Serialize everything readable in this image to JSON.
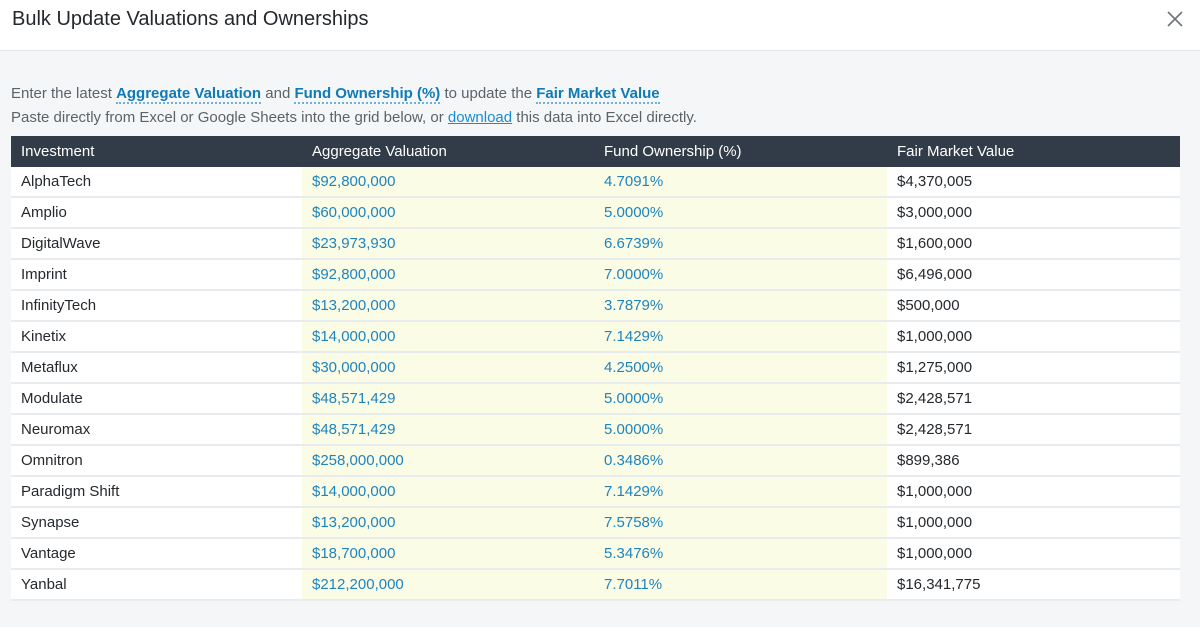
{
  "dialog": {
    "title": "Bulk Update Valuations and Ownerships",
    "close_glyph": "✕"
  },
  "intro": {
    "line1_prefix": "Enter the latest ",
    "term_aggregate": "Aggregate Valuation",
    "and": " and ",
    "term_ownership": "Fund Ownership (%)",
    "to_update": " to update the ",
    "term_fmv": "Fair Market Value",
    "line2_prefix": "Paste directly from Excel or Google Sheets into the grid below, or ",
    "download_link": "download",
    "line2_suffix": " this data into Excel directly."
  },
  "table": {
    "columns": [
      "Investment",
      "Aggregate Valuation",
      "Fund Ownership (%)",
      "Fair Market Value"
    ],
    "rows": [
      {
        "investment": "AlphaTech",
        "valuation": "$92,800,000",
        "ownership": "4.7091%",
        "fmv": "$4,370,005"
      },
      {
        "investment": "Amplio",
        "valuation": "$60,000,000",
        "ownership": "5.0000%",
        "fmv": "$3,000,000"
      },
      {
        "investment": "DigitalWave",
        "valuation": "$23,973,930",
        "ownership": "6.6739%",
        "fmv": "$1,600,000"
      },
      {
        "investment": "Imprint",
        "valuation": "$92,800,000",
        "ownership": "7.0000%",
        "fmv": "$6,496,000"
      },
      {
        "investment": "InfinityTech",
        "valuation": "$13,200,000",
        "ownership": "3.7879%",
        "fmv": "$500,000"
      },
      {
        "investment": "Kinetix",
        "valuation": "$14,000,000",
        "ownership": "7.1429%",
        "fmv": "$1,000,000"
      },
      {
        "investment": "Metaflux",
        "valuation": "$30,000,000",
        "ownership": "4.2500%",
        "fmv": "$1,275,000"
      },
      {
        "investment": "Modulate",
        "valuation": "$48,571,429",
        "ownership": "5.0000%",
        "fmv": "$2,428,571"
      },
      {
        "investment": "Neuromax",
        "valuation": "$48,571,429",
        "ownership": "5.0000%",
        "fmv": "$2,428,571"
      },
      {
        "investment": "Omnitron",
        "valuation": "$258,000,000",
        "ownership": "0.3486%",
        "fmv": "$899,386"
      },
      {
        "investment": "Paradigm Shift",
        "valuation": "$14,000,000",
        "ownership": "7.1429%",
        "fmv": "$1,000,000"
      },
      {
        "investment": "Synapse",
        "valuation": "$13,200,000",
        "ownership": "7.5758%",
        "fmv": "$1,000,000"
      },
      {
        "investment": "Vantage",
        "valuation": "$18,700,000",
        "ownership": "5.3476%",
        "fmv": "$1,000,000"
      },
      {
        "investment": "Yanbal",
        "valuation": "$212,200,000",
        "ownership": "7.7011%",
        "fmv": "$16,341,775"
      }
    ]
  },
  "colors": {
    "header_bg": "#313c48",
    "editable_bg": "#fbfce6",
    "editable_text": "#1f84bd",
    "term_text": "#0f7bb6",
    "link_text": "#1a8cd6"
  }
}
